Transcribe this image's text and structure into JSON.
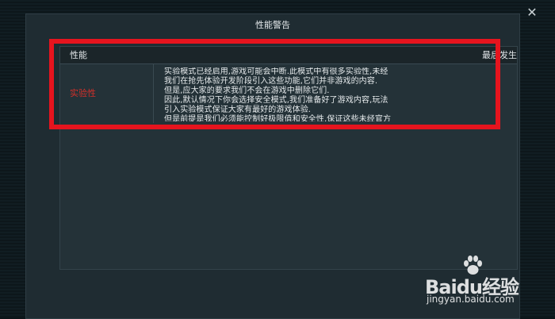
{
  "dialog": {
    "title": "性能警告",
    "close_glyph": "✕"
  },
  "table": {
    "header": {
      "performance": "性能",
      "last_occurrence": "最后发生"
    },
    "rows": [
      {
        "name": "实验性",
        "description_lines": [
          "实验模式已经启用,游戏可能会中断.此模式中有很多实验性,未经",
          "我们在抢先体验开发阶段引入这些功能,它们并非游戏的内容.",
          "但是,应大家的要求我们不会在游戏中删除它们.",
          "因此,默认情况下你会选择安全模式,我们准备好了游戏内容,玩法",
          "引入实验模式保证大家有最好的游戏体验.",
          "但是前提是我们必须能控制好极限值和安全性,保证这些未经官方"
        ]
      }
    ]
  },
  "watermark": {
    "brand": "Baidu经验",
    "site": "jingyan.baidu.com"
  },
  "colors": {
    "highlight": "#e6141e",
    "name_red": "#d3302a"
  }
}
